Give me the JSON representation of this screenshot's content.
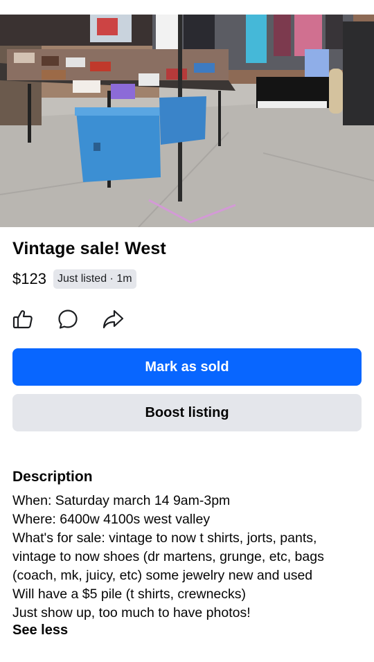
{
  "listing": {
    "title": "Vintage sale! West",
    "price": "$123",
    "listed_badge": "Just listed · 1m"
  },
  "actions": {
    "like_icon": "thumbs-up-icon",
    "message_icon": "chat-bubble-icon",
    "share_icon": "share-arrow-icon"
  },
  "buttons": {
    "mark_sold": "Mark as sold",
    "boost": "Boost listing"
  },
  "description": {
    "heading": "Description",
    "lines": [
      "When: Saturday march 14 9am-3pm",
      "Where: 6400w 4100s west valley",
      "What's for sale: vintage to now t shirts, jorts, pants,",
      "vintage to now shoes (dr martens, grunge, etc, bags",
      "(coach, mk, juicy, etc) some jewelry new and used",
      "Will have a $5 pile (t shirts, crewnecks)",
      "Just show up, too much to have photos!"
    ],
    "toggle_label": "See less"
  },
  "colors": {
    "primary": "#0866ff",
    "secondary_bg": "#e4e6eb",
    "text": "#050505"
  }
}
